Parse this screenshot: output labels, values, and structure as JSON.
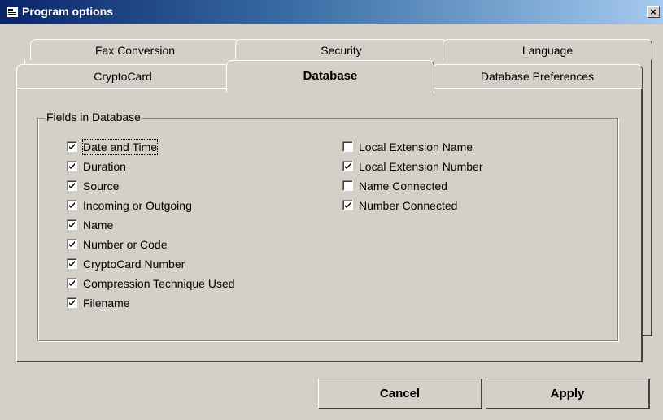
{
  "window": {
    "title": "Program options",
    "close_label": "×"
  },
  "tabs": {
    "back_row": [
      "Fax Conversion",
      "Security",
      "Language"
    ],
    "front_row": [
      "CryptoCard",
      "Database",
      "Database Preferences"
    ],
    "active": "Database"
  },
  "group": {
    "legend": "Fields in Database",
    "left_fields": [
      {
        "label": "Date  and Time",
        "checked": true
      },
      {
        "label": "Duration",
        "checked": true
      },
      {
        "label": "Source",
        "checked": true
      },
      {
        "label": "Incoming or Outgoing",
        "checked": true
      },
      {
        "label": "Name",
        "checked": true
      },
      {
        "label": "Number or Code",
        "checked": true
      },
      {
        "label": "CryptoCard Number",
        "checked": true
      },
      {
        "label": "Compression Technique Used",
        "checked": true
      },
      {
        "label": "Filename",
        "checked": true
      }
    ],
    "right_fields": [
      {
        "label": "Local Extension Name",
        "checked": false
      },
      {
        "label": "Local Extension Number",
        "checked": true
      },
      {
        "label": "Name Connected",
        "checked": false
      },
      {
        "label": "Number Connected",
        "checked": true
      }
    ]
  },
  "buttons": {
    "cancel": "Cancel",
    "apply": "Apply"
  }
}
